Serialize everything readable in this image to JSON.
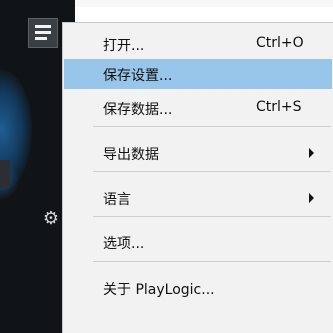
{
  "app": {
    "menu_button_icon": "hamburger-menu-icon",
    "settings_icon": "gear-icon"
  },
  "menu": {
    "items": [
      {
        "label": "打开...",
        "shortcut": "Ctrl+O",
        "submenu": false,
        "highlighted": false
      },
      {
        "label": "保存设置...",
        "shortcut": "",
        "submenu": false,
        "highlighted": true
      },
      {
        "label": "保存数据...",
        "shortcut": "Ctrl+S",
        "submenu": false,
        "highlighted": false
      },
      {
        "label": "导出数据",
        "shortcut": "",
        "submenu": true,
        "highlighted": false
      },
      {
        "label": "语言",
        "shortcut": "",
        "submenu": true,
        "highlighted": false
      },
      {
        "label": "选项...",
        "shortcut": "",
        "submenu": false,
        "highlighted": false
      },
      {
        "label": "关于 PlayLogic...",
        "shortcut": "",
        "submenu": false,
        "highlighted": false
      }
    ]
  },
  "colors": {
    "highlight": "#98c6ea",
    "menu_bg": "#f2f2f2",
    "app_bg": "#111417"
  }
}
